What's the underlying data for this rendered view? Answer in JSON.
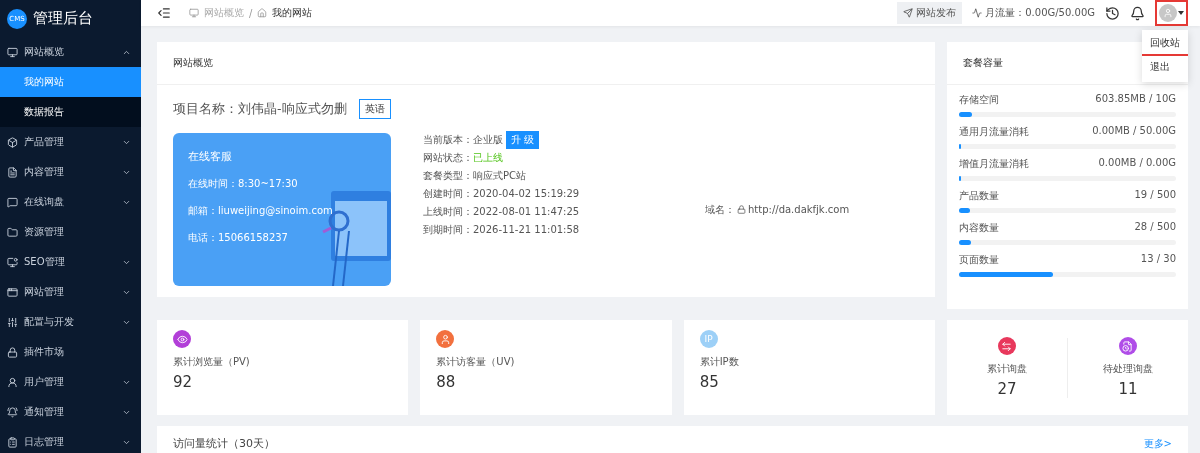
{
  "brand": {
    "logo": "CMS",
    "title": "管理后台"
  },
  "sidebar": {
    "items": [
      {
        "kind": "monitor",
        "label": "网站概览",
        "expanded": true,
        "children": [
          {
            "label": "我的网站",
            "selected": true
          },
          {
            "label": "数据报告",
            "selected": false
          }
        ]
      },
      {
        "kind": "box",
        "label": "产品管理",
        "expanded": false
      },
      {
        "kind": "doc",
        "label": "内容管理",
        "expanded": false
      },
      {
        "kind": "chat",
        "label": "在线询盘",
        "expanded": false
      },
      {
        "kind": "folder",
        "label": "资源管理"
      },
      {
        "kind": "screen",
        "label": "SEO管理",
        "expanded": false
      },
      {
        "kind": "window",
        "label": "网站管理",
        "expanded": false
      },
      {
        "kind": "sliders",
        "label": "配置与开发",
        "expanded": false
      },
      {
        "kind": "lock",
        "label": "插件市场"
      },
      {
        "kind": "user",
        "label": "用户管理",
        "expanded": false
      },
      {
        "kind": "bell",
        "label": "通知管理",
        "expanded": false
      },
      {
        "kind": "log",
        "label": "日志管理",
        "expanded": false
      }
    ]
  },
  "header": {
    "breadcrumb": [
      "网站概览",
      "我的网站"
    ],
    "breadcrumb_separator": "/",
    "publish_button": "网站发布",
    "traffic": "月流量：0.00G/50.00G",
    "avatar_highlighted": true,
    "menu": [
      {
        "label": "回收站",
        "highlighted": true
      },
      {
        "label": "退出",
        "highlighted": false
      }
    ]
  },
  "overview": {
    "title": "网站概览",
    "project": "项目名称：刘伟晶-响应式勿删",
    "language": "英语",
    "service": {
      "title": "在线客服",
      "lines": [
        "在线时间：8:30~17:30",
        "邮箱：liuweijing@sinoim.com",
        "电话：15066158237"
      ]
    },
    "info": [
      {
        "label": "当前版本：",
        "value": "企业版",
        "action": "升 级",
        "kind": "plain"
      },
      {
        "label": "网站状态：",
        "value": "已上线",
        "kind": "success"
      },
      {
        "label": "套餐类型：",
        "value": "响应式PC站",
        "kind": "plain"
      },
      {
        "label": "创建时间：",
        "value": "2020-04-02 15:19:29",
        "kind": "plain"
      },
      {
        "label": "上线时间：",
        "value": "2022-08-01 11:47:25",
        "kind": "plain"
      },
      {
        "label": "到期时间：",
        "value": "2026-11-21 11:01:58",
        "kind": "plain"
      }
    ],
    "domain": {
      "label": "域名：",
      "value": "http://da.dakfjk.com"
    }
  },
  "package": {
    "title": "套餐容量",
    "items": [
      {
        "label": "存储空间",
        "reading": "603.85MB / 10G",
        "level": 0.06
      },
      {
        "label": "通用月流量消耗",
        "reading": "0.00MB / 50.00G",
        "level": 0
      },
      {
        "label": "增值月流量消耗",
        "reading": "0.00MB / 0.00G",
        "level": 0
      },
      {
        "label": "产品数量",
        "reading": "19 / 500",
        "level": 0.038
      },
      {
        "label": "内容数量",
        "reading": "28 / 500",
        "level": 0.056
      },
      {
        "label": "页面数量",
        "reading": "13 / 30",
        "level": 0.433
      }
    ]
  },
  "stats": [
    {
      "kind": "eye",
      "label": "累计浏览量（PV)",
      "value": "92"
    },
    {
      "kind": "user",
      "label": "累计访客量（UV)",
      "value": "88"
    },
    {
      "kind": "ip",
      "badge": "IP",
      "label": "累计IP数",
      "value": "85"
    }
  ],
  "inquiries": [
    {
      "kind": "swap",
      "label": "累计询盘",
      "value": "27"
    },
    {
      "kind": "pending",
      "label": "待处理询盘",
      "value": "11"
    }
  ],
  "visits": {
    "title": "访问量统计（30天）",
    "more": "更多>"
  }
}
